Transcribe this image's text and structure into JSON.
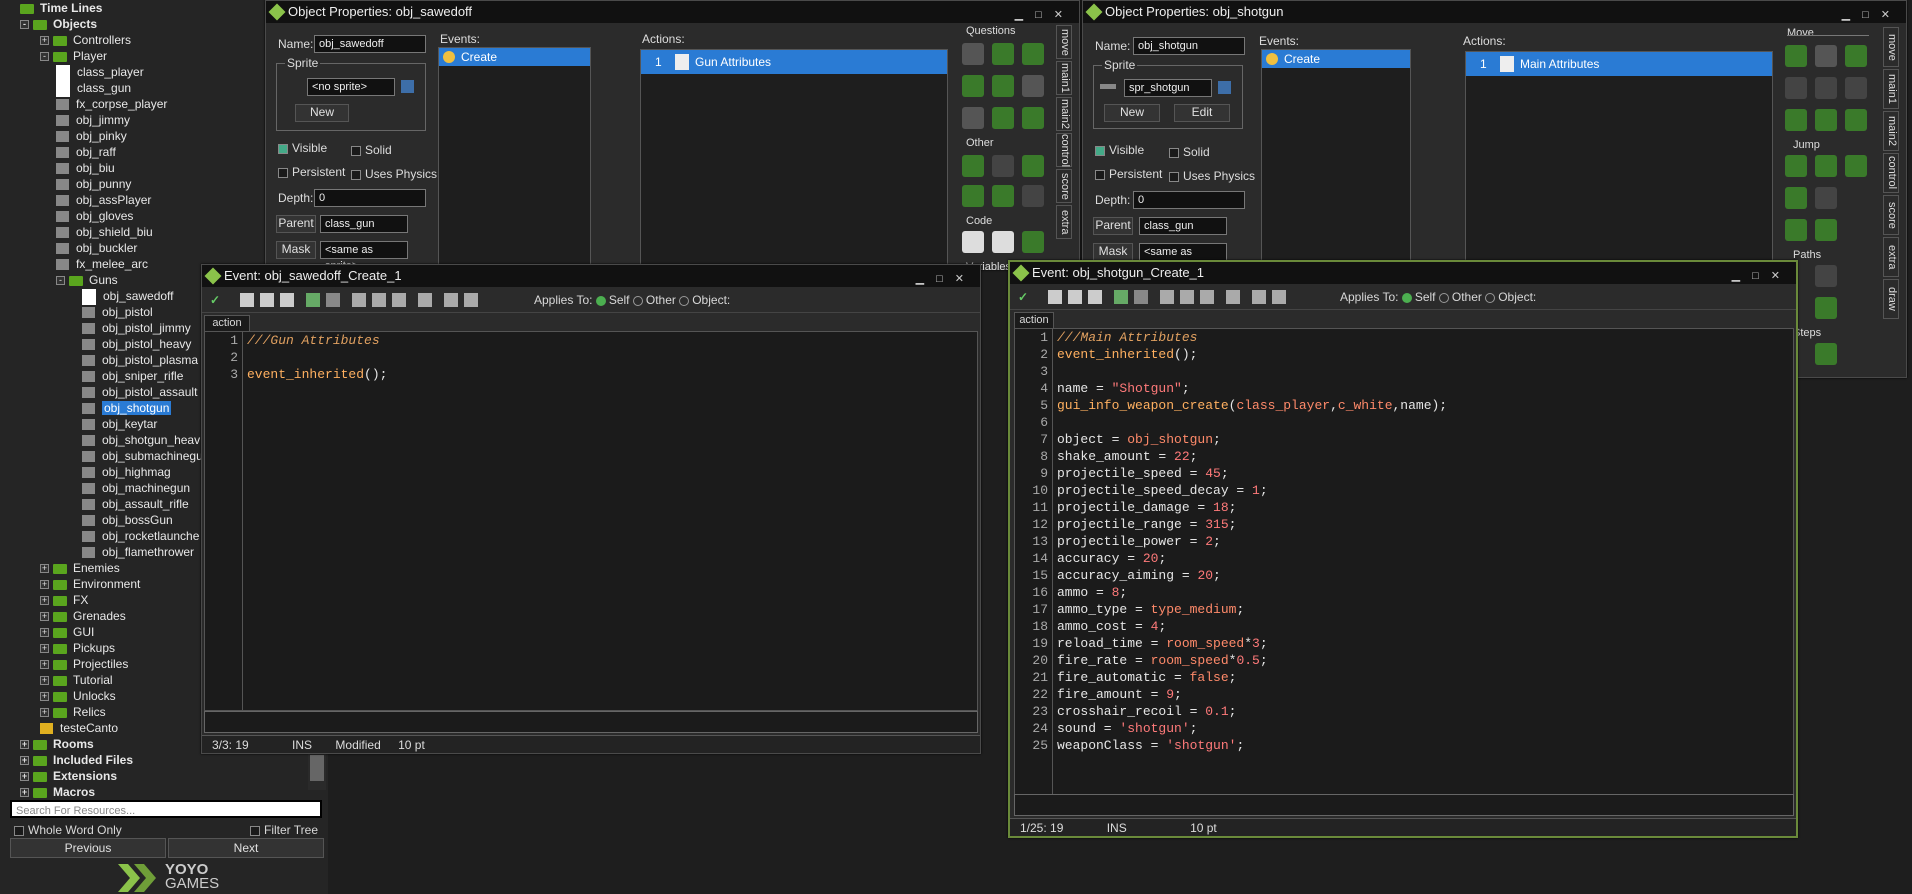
{
  "tree": {
    "items": [
      {
        "label": "Time Lines",
        "bold": true,
        "type": "folder",
        "indent": 0
      },
      {
        "label": "Objects",
        "bold": true,
        "type": "folder",
        "indent": 0,
        "exp": "-"
      },
      {
        "label": "Controllers",
        "type": "folder",
        "indent": 1,
        "exp": "+"
      },
      {
        "label": "Player",
        "type": "folder",
        "indent": 1,
        "exp": "-"
      },
      {
        "label": "class_player",
        "type": "white",
        "indent": 2
      },
      {
        "label": "class_gun",
        "type": "white",
        "indent": 2
      },
      {
        "label": "fx_corpse_player",
        "type": "spr",
        "indent": 2
      },
      {
        "label": "obj_jimmy",
        "type": "spr",
        "indent": 2
      },
      {
        "label": "obj_pinky",
        "type": "spr",
        "indent": 2
      },
      {
        "label": "obj_raff",
        "type": "spr",
        "indent": 2
      },
      {
        "label": "obj_biu",
        "type": "spr",
        "indent": 2
      },
      {
        "label": "obj_punny",
        "type": "spr",
        "indent": 2
      },
      {
        "label": "obj_assPlayer",
        "type": "spr",
        "indent": 2
      },
      {
        "label": "obj_gloves",
        "type": "spr",
        "indent": 2
      },
      {
        "label": "obj_shield_biu",
        "type": "spr",
        "indent": 2
      },
      {
        "label": "obj_buckler",
        "type": "spr",
        "indent": 2
      },
      {
        "label": "fx_melee_arc",
        "type": "spr",
        "indent": 2
      },
      {
        "label": "Guns",
        "type": "folder",
        "indent": 2,
        "exp": "-"
      },
      {
        "label": "obj_sawedoff",
        "type": "white",
        "indent": 3
      },
      {
        "label": "obj_pistol",
        "type": "spr",
        "indent": 3
      },
      {
        "label": "obj_pistol_jimmy",
        "type": "spr",
        "indent": 3
      },
      {
        "label": "obj_pistol_heavy",
        "type": "spr",
        "indent": 3
      },
      {
        "label": "obj_pistol_plasma",
        "type": "spr",
        "indent": 3
      },
      {
        "label": "obj_sniper_rifle",
        "type": "spr",
        "indent": 3
      },
      {
        "label": "obj_pistol_assault",
        "type": "spr",
        "indent": 3
      },
      {
        "label": "obj_shotgun",
        "type": "spr",
        "indent": 3,
        "sel": true
      },
      {
        "label": "obj_keytar",
        "type": "spr",
        "indent": 3
      },
      {
        "label": "obj_shotgun_heav",
        "type": "spr",
        "indent": 3
      },
      {
        "label": "obj_submachinegu",
        "type": "spr",
        "indent": 3
      },
      {
        "label": "obj_highmag",
        "type": "spr",
        "indent": 3
      },
      {
        "label": "obj_machinegun",
        "type": "spr",
        "indent": 3
      },
      {
        "label": "obj_assault_rifle",
        "type": "spr",
        "indent": 3
      },
      {
        "label": "obj_bossGun",
        "type": "spr",
        "indent": 3
      },
      {
        "label": "obj_rocketlaunche",
        "type": "spr",
        "indent": 3
      },
      {
        "label": "obj_flamethrower",
        "type": "spr",
        "indent": 3
      },
      {
        "label": "Enemies",
        "type": "folder",
        "indent": 1,
        "exp": "+"
      },
      {
        "label": "Environment",
        "type": "folder",
        "indent": 1,
        "exp": "+"
      },
      {
        "label": "FX",
        "type": "folder",
        "indent": 1,
        "exp": "+"
      },
      {
        "label": "Grenades",
        "type": "folder",
        "indent": 1,
        "exp": "+"
      },
      {
        "label": "GUI",
        "type": "folder",
        "indent": 1,
        "exp": "+"
      },
      {
        "label": "Pickups",
        "type": "folder",
        "indent": 1,
        "exp": "+"
      },
      {
        "label": "Projectiles",
        "type": "folder",
        "indent": 1,
        "exp": "+"
      },
      {
        "label": "Tutorial",
        "type": "folder",
        "indent": 1,
        "exp": "+"
      },
      {
        "label": "Unlocks",
        "type": "folder",
        "indent": 1,
        "exp": "+"
      },
      {
        "label": "Relics",
        "type": "folder",
        "indent": 1,
        "exp": "+"
      },
      {
        "label": "testeCanto",
        "type": "yellow",
        "indent": 1
      },
      {
        "label": "Rooms",
        "bold": true,
        "type": "folder",
        "indent": 0,
        "exp": "+"
      },
      {
        "label": "Included Files",
        "bold": true,
        "type": "folder",
        "indent": 0,
        "exp": "+"
      },
      {
        "label": "Extensions",
        "bold": true,
        "type": "folder",
        "indent": 0,
        "exp": "+"
      },
      {
        "label": "Macros",
        "bold": true,
        "type": "folder",
        "indent": 0,
        "exp": "+"
      }
    ],
    "search_placeholder": "Search For Resources...",
    "whole_word": "Whole Word Only",
    "filter_tree": "Filter Tree",
    "previous": "Previous",
    "next": "Next",
    "logo_top": "YOYO",
    "logo_bottom": "GAMES"
  },
  "op1": {
    "title": "Object Properties: obj_sawedoff",
    "name_label": "Name:",
    "name_value": "obj_sawedoff",
    "sprite_label": "Sprite",
    "sprite_value": "<no sprite>",
    "new_btn": "New",
    "visible": "Visible",
    "solid": "Solid",
    "persistent": "Persistent",
    "physics": "Uses Physics",
    "depth_label": "Depth:",
    "depth_value": "0",
    "parent_btn": "Parent",
    "parent_value": "class_gun",
    "mask_btn": "Mask",
    "mask_value": "<same as sprite>",
    "events_label": "Events:",
    "event": "Create",
    "actions_label": "Actions:",
    "action_num": "1",
    "action": "Gun Attributes",
    "sec_questions": "Questions",
    "sec_other": "Other",
    "sec_code": "Code",
    "sec_variables": "Variables",
    "tabs": [
      "move",
      "main1",
      "main2",
      "control",
      "score",
      "extra"
    ]
  },
  "op2": {
    "title": "Object Properties: obj_shotgun",
    "name_label": "Name:",
    "name_value": "obj_shotgun",
    "sprite_label": "Sprite",
    "sprite_value": "spr_shotgun",
    "new_btn": "New",
    "edit_btn": "Edit",
    "visible": "Visible",
    "solid": "Solid",
    "persistent": "Persistent",
    "physics": "Uses Physics",
    "depth_label": "Depth:",
    "depth_value": "0",
    "parent_btn": "Parent",
    "parent_value": "class_gun",
    "mask_btn": "Mask",
    "mask_value": "<same as sprite>",
    "events_label": "Events:",
    "event": "Create",
    "actions_label": "Actions:",
    "action_num": "1",
    "action": "Main Attributes",
    "sec_move": "Move",
    "sec_jump": "Jump",
    "sec_paths": "Paths",
    "sec_steps": "Steps",
    "tabs": [
      "move",
      "main1",
      "main2",
      "control",
      "score",
      "extra",
      "draw"
    ]
  },
  "ev1": {
    "title": "Event: obj_sawedoff_Create_1",
    "applies": "Applies To:",
    "self": "Self",
    "other": "Other",
    "object": "Object:",
    "tab": "action",
    "lines": [
      [
        [
          "kw-com",
          "///Gun Attributes"
        ]
      ],
      [],
      [
        [
          "fn",
          "event_inherited"
        ],
        [
          "plain",
          "();"
        ]
      ]
    ],
    "status_pos": "3/3: 19",
    "status_ins": "INS",
    "status_mod": "Modified",
    "status_pt": "10 pt"
  },
  "ev2": {
    "title": "Event: obj_shotgun_Create_1",
    "applies": "Applies To:",
    "self": "Self",
    "other": "Other",
    "object": "Object:",
    "tab": "action",
    "lines": [
      [
        [
          "kw-com",
          "///Main Attributes"
        ]
      ],
      [
        [
          "fn",
          "event_inherited"
        ],
        [
          "plain",
          "();"
        ]
      ],
      [],
      [
        [
          "plain",
          "name = "
        ],
        [
          "str",
          "\"Shotgun\""
        ],
        [
          "plain",
          ";"
        ]
      ],
      [
        [
          "fn",
          "gui_info_weapon_create"
        ],
        [
          "plain",
          "("
        ],
        [
          "const",
          "class_player"
        ],
        [
          "plain",
          ","
        ],
        [
          "const",
          "c_white"
        ],
        [
          "plain",
          ",name);"
        ]
      ],
      [],
      [
        [
          "plain",
          "object = "
        ],
        [
          "const",
          "obj_shotgun"
        ],
        [
          "plain",
          ";"
        ]
      ],
      [
        [
          "plain",
          "shake_amount = "
        ],
        [
          "num",
          "22"
        ],
        [
          "plain",
          ";"
        ]
      ],
      [
        [
          "plain",
          "projectile_speed = "
        ],
        [
          "num",
          "45"
        ],
        [
          "plain",
          ";"
        ]
      ],
      [
        [
          "plain",
          "projectile_speed_decay = "
        ],
        [
          "num",
          "1"
        ],
        [
          "plain",
          ";"
        ]
      ],
      [
        [
          "plain",
          "projectile_damage = "
        ],
        [
          "num",
          "18"
        ],
        [
          "plain",
          ";"
        ]
      ],
      [
        [
          "plain",
          "projectile_range = "
        ],
        [
          "num",
          "315"
        ],
        [
          "plain",
          ";"
        ]
      ],
      [
        [
          "plain",
          "projectile_power = "
        ],
        [
          "num",
          "2"
        ],
        [
          "plain",
          ";"
        ]
      ],
      [
        [
          "plain",
          "accuracy = "
        ],
        [
          "num",
          "20"
        ],
        [
          "plain",
          ";"
        ]
      ],
      [
        [
          "plain",
          "accuracy_aiming = "
        ],
        [
          "num",
          "20"
        ],
        [
          "plain",
          ";"
        ]
      ],
      [
        [
          "plain",
          "ammo = "
        ],
        [
          "num",
          "8"
        ],
        [
          "plain",
          ";"
        ]
      ],
      [
        [
          "plain",
          "ammo_type = "
        ],
        [
          "const",
          "type_medium"
        ],
        [
          "plain",
          ";"
        ]
      ],
      [
        [
          "plain",
          "ammo_cost = "
        ],
        [
          "num",
          "4"
        ],
        [
          "plain",
          ";"
        ]
      ],
      [
        [
          "plain",
          "reload_time = "
        ],
        [
          "const",
          "room_speed"
        ],
        [
          "plain",
          "*"
        ],
        [
          "num",
          "3"
        ],
        [
          "plain",
          ";"
        ]
      ],
      [
        [
          "plain",
          "fire_rate = "
        ],
        [
          "const",
          "room_speed"
        ],
        [
          "plain",
          "*"
        ],
        [
          "num",
          "0.5"
        ],
        [
          "plain",
          ";"
        ]
      ],
      [
        [
          "plain",
          "fire_automatic = "
        ],
        [
          "const",
          "false"
        ],
        [
          "plain",
          ";"
        ]
      ],
      [
        [
          "plain",
          "fire_amount = "
        ],
        [
          "num",
          "9"
        ],
        [
          "plain",
          ";"
        ]
      ],
      [
        [
          "plain",
          "crosshair_recoil = "
        ],
        [
          "num",
          "0.1"
        ],
        [
          "plain",
          ";"
        ]
      ],
      [
        [
          "plain",
          "sound = "
        ],
        [
          "str",
          "'shotgun'"
        ],
        [
          "plain",
          ";"
        ]
      ],
      [
        [
          "plain",
          "weaponClass = "
        ],
        [
          "str",
          "'shotgun'"
        ],
        [
          "plain",
          ";"
        ]
      ]
    ],
    "status_pos": "1/25: 19",
    "status_ins": "INS",
    "status_pt": "10 pt"
  },
  "colors": {
    "accent": "#8bc34a",
    "select": "#2a7bd4",
    "folder": "#5aa51e"
  }
}
